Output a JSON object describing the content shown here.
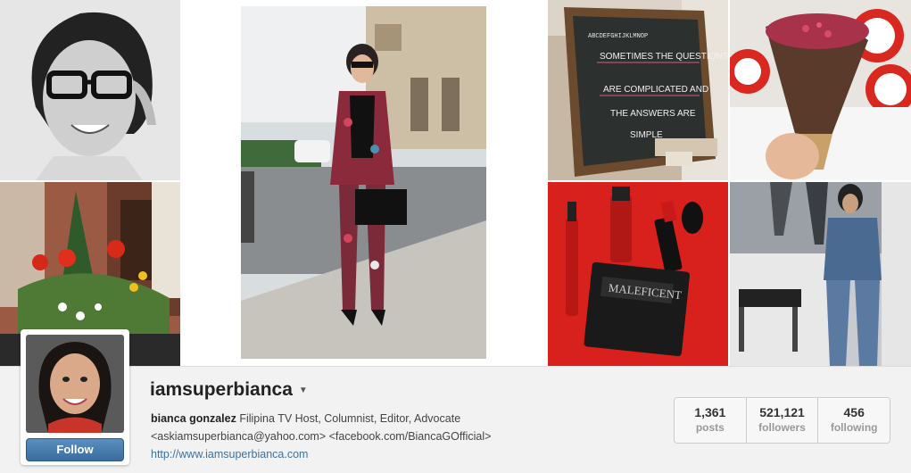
{
  "profile": {
    "username": "iamsuperbianca",
    "full_name": "bianca gonzalez",
    "bio": "Filipina TV Host, Columnist, Editor, Advocate",
    "bio_line2": "<askiamsuperbianca@yahoo.com> <facebook.com/BiancaGOfficial>",
    "website": "http://www.iamsuperbianca.com",
    "follow_label": "Follow"
  },
  "stats": [
    {
      "value": "1,361",
      "label": "posts"
    },
    {
      "value": "521,121",
      "label": "followers"
    },
    {
      "value": "456",
      "label": "following"
    }
  ],
  "chalkboard": {
    "lines": [
      "SOMETIMES THE QUESTIONS",
      "ARE COMPLICATED AND",
      "THE ANSWERS ARE",
      "SIMPLE"
    ]
  },
  "palette": "MALEFICENT",
  "colors": {
    "link": "#3f729b",
    "follow_button": "#3a6d9e"
  }
}
